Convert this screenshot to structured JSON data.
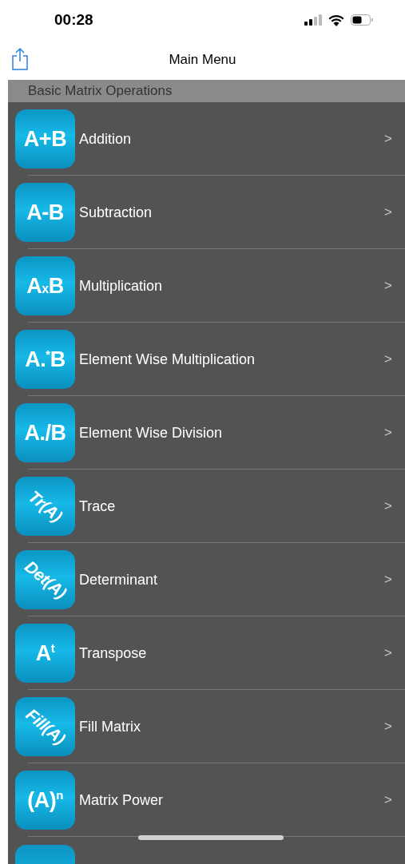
{
  "status_bar": {
    "time": "00:28"
  },
  "nav_bar": {
    "title": "Main Menu"
  },
  "section": {
    "title": "Basic Matrix Operations"
  },
  "items": [
    {
      "kind": "flat",
      "icon_text": "A+B",
      "label": "Addition",
      "chevron": ">"
    },
    {
      "kind": "flat",
      "icon_text": "A-B",
      "label": "Subtraction",
      "chevron": ">"
    },
    {
      "kind": "flat",
      "icon_text": "A$_{x}$B",
      "label": "Multiplication",
      "chevron": ">"
    },
    {
      "kind": "flat",
      "icon_text": "A.$^{*}$B",
      "label": "Element Wise Multiplication",
      "chevron": ">"
    },
    {
      "kind": "flat",
      "icon_text": "A./B",
      "label": "Element Wise Division",
      "chevron": ">"
    },
    {
      "kind": "slanted",
      "icon_text": "Tr(A)",
      "label": "Trace",
      "chevron": ">"
    },
    {
      "kind": "slanted",
      "icon_text": "Det(A)",
      "label": "Determinant",
      "chevron": ">"
    },
    {
      "kind": "flat",
      "icon_text": "A$^{t}$",
      "label": "Transpose",
      "chevron": ">"
    },
    {
      "kind": "slanted",
      "icon_text": "Fill(A)",
      "label": "Fill Matrix",
      "chevron": ">"
    },
    {
      "kind": "flat",
      "icon_text": "(A)$^{n}$",
      "label": "Matrix Power",
      "chevron": ">"
    }
  ]
}
